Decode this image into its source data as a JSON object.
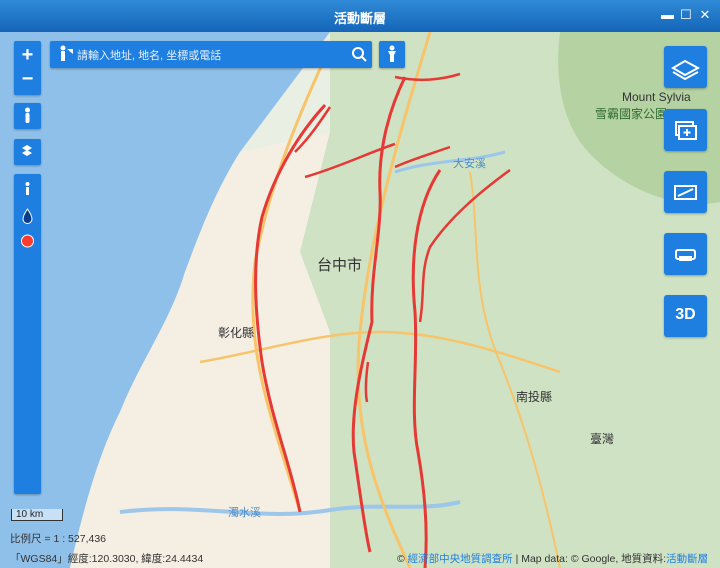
{
  "window": {
    "title": "活動斷層",
    "minimize_glyph": "▬",
    "maximize_glyph": "☐",
    "close_glyph": "✕"
  },
  "search": {
    "placeholder": "請輸入地址, 地名, 坐標或電話"
  },
  "left_toolbar": {
    "zoom_in": "+",
    "zoom_out": "−"
  },
  "right_toolbar": {
    "three_d_label": "3D"
  },
  "map_labels": {
    "taichung": "台中市",
    "changhua": "彰化縣",
    "nantou": "南投縣",
    "taiwan": "臺灣",
    "mount_sylvia": "Mount Sylvia",
    "shei_pa": "雪霸國家公園",
    "dajia_river": "大安溪",
    "zhuoshui_river": "濁水溪"
  },
  "scale": {
    "bar_label": "10 km",
    "ratio_text": "比例尺 = 1 : 527,436"
  },
  "coords": {
    "text": "「WGS84」經度:120.3030, 緯度:24.4434"
  },
  "attribution": {
    "prefix": "© ",
    "source_link": "經濟部中央地質調查所",
    "map_data": " | Map data: © Google, 地質資料:",
    "layer_link": "活動斷層"
  }
}
